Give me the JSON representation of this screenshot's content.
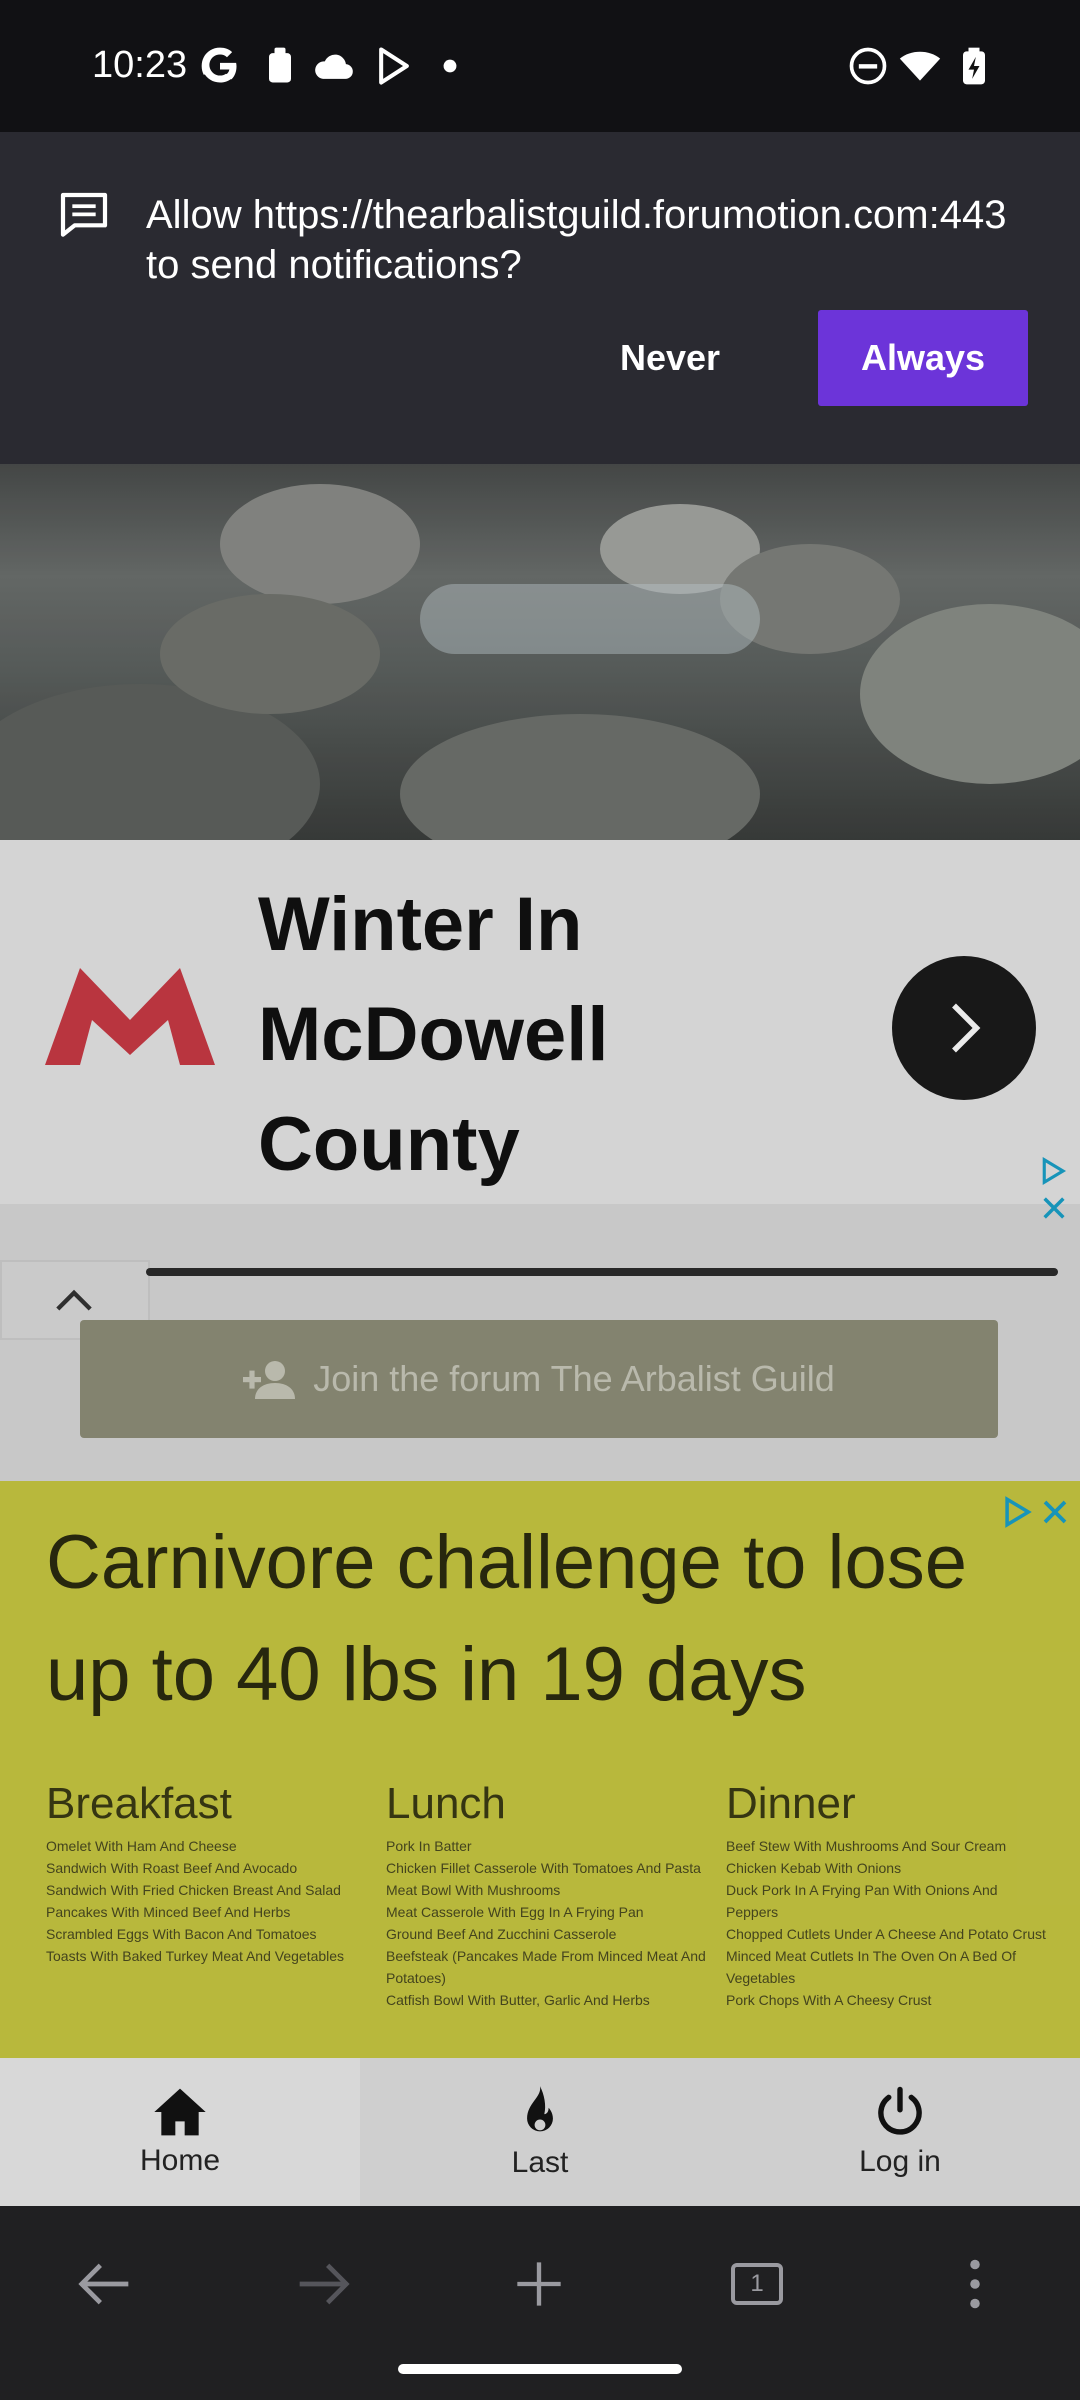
{
  "status_bar": {
    "time": "10:23",
    "left_icons": [
      "google-icon",
      "clipboard-icon",
      "cloud-icon",
      "play-store-icon",
      "dot-icon"
    ],
    "right_icons": [
      "do-not-disturb-icon",
      "wifi-icon",
      "battery-icon"
    ]
  },
  "notification_prompt": {
    "message": "Allow https://thearbalistguild.forumotion.com:443 to send notifications?",
    "never_label": "Never",
    "always_label": "Always",
    "accent_color": "#6c34d9"
  },
  "ad_banner": {
    "title": "Winter In McDowell County",
    "logo": "red-m-logo-icon",
    "next_icon": "chevron-right-icon"
  },
  "join_button": {
    "label": "Join the forum The Arbalist Guild"
  },
  "carnivore_ad": {
    "headline": "Carnivore challenge to lose up to 40 lbs in 19 days",
    "columns": [
      {
        "title": "Breakfast",
        "lines": [
          "Omelet With Ham And Cheese",
          "Sandwich With Roast Beef And Avocado",
          "Sandwich With Fried Chicken Breast And Salad",
          "Pancakes With Minced Beef And Herbs",
          "Scrambled Eggs With Bacon And Tomatoes",
          "Toasts With Baked Turkey Meat And Vegetables"
        ]
      },
      {
        "title": "Lunch",
        "lines": [
          "Pork In Batter",
          "Chicken Fillet Casserole With Tomatoes And Pasta",
          "Meat Bowl With Mushrooms",
          "Meat Casserole With Egg In A Frying Pan",
          "Ground Beef And Zucchini Casserole",
          "Beefsteak (Pancakes Made From Minced Meat And Potatoes)",
          "Catfish Bowl With Butter, Garlic And Herbs"
        ]
      },
      {
        "title": "Dinner",
        "lines": [
          "Beef Stew With Mushrooms And Sour Cream",
          "Chicken Kebab With Onions",
          "Duck Pork In A Frying Pan With Onions And Peppers",
          "Chopped Cutlets Under A Cheese And Potato Crust",
          "Minced Meat Cutlets In The Oven On A Bed Of Vegetables",
          "Pork Chops With A Cheesy Crust"
        ]
      }
    ]
  },
  "forum_nav": [
    {
      "label": "Home",
      "icon": "home-icon"
    },
    {
      "label": "Last",
      "icon": "flame-icon"
    },
    {
      "label": "Log in",
      "icon": "power-icon"
    }
  ],
  "browser_bar": {
    "tab_count": "1",
    "icons": [
      "back-arrow-icon",
      "forward-arrow-icon",
      "new-tab-plus-icon",
      "tab-counter-icon",
      "overflow-menu-icon"
    ]
  }
}
